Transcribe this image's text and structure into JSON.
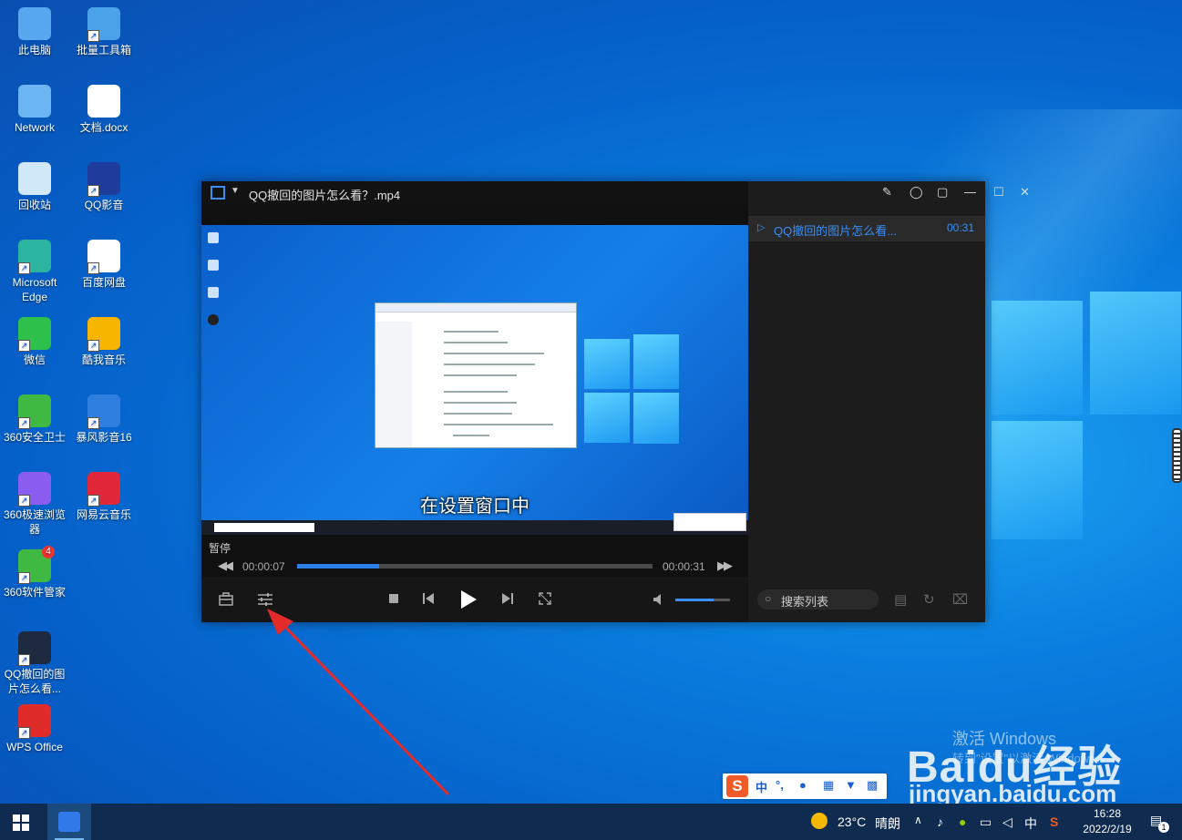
{
  "desktop": {
    "icons": [
      {
        "label": "此电脑",
        "icon": "computer-icon"
      },
      {
        "label": "批量工具箱",
        "icon": "toolbox-icon"
      },
      {
        "label": "Network",
        "icon": "network-icon"
      },
      {
        "label": "文档.docx",
        "icon": "word-doc-icon"
      },
      {
        "label": "回收站",
        "icon": "recycle-bin-icon"
      },
      {
        "label": "QQ影音",
        "icon": "qq-player-icon"
      },
      {
        "label": "Microsoft Edge",
        "icon": "edge-icon"
      },
      {
        "label": "百度网盘",
        "icon": "baidu-netdisk-icon"
      },
      {
        "label": "微信",
        "icon": "wechat-icon"
      },
      {
        "label": "酷我音乐",
        "icon": "kuwo-music-icon"
      },
      {
        "label": "360安全卫士",
        "icon": "360-safe-icon"
      },
      {
        "label": "暴风影音16",
        "icon": "baofeng-icon"
      },
      {
        "label": "360极速浏览器",
        "icon": "360-browser-icon"
      },
      {
        "label": "网易云音乐",
        "icon": "netease-music-icon"
      },
      {
        "label": "360软件管家",
        "icon": "360-software-icon"
      },
      {
        "label": "QQ撤回的图片怎么看...",
        "icon": "video-file-icon"
      },
      {
        "label": "WPS Office",
        "icon": "wps-icon"
      }
    ],
    "badge_360": "4"
  },
  "player": {
    "title": "QQ撤回的图片怎么看？.mp4",
    "subtitle": "在设置窗口中",
    "status": "暂停",
    "current_time": "00:00:07",
    "total_time": "00:00:31",
    "progress": 0.23,
    "volume": 0.7,
    "playlist": {
      "items": [
        {
          "name": "QQ撤回的图片怎么看...",
          "duration": "00:31"
        }
      ],
      "search_placeholder": "搜索列表"
    }
  },
  "ime": {
    "mode": "中"
  },
  "taskbar": {
    "weather_temp": "23°C",
    "weather_text": "晴朗",
    "time": "16:28",
    "date": "2022/2/19",
    "notification_count": "1"
  },
  "watermark": {
    "activate_title": "激活 Windows",
    "activate_sub": "转到\"设置\"以激活 Windows。",
    "baidu_logo": "Baidu经验",
    "baidu_url": "jingyan.baidu.com"
  },
  "colors": {
    "accent": "#2b7fe6",
    "arrow": "#e52a2a"
  }
}
